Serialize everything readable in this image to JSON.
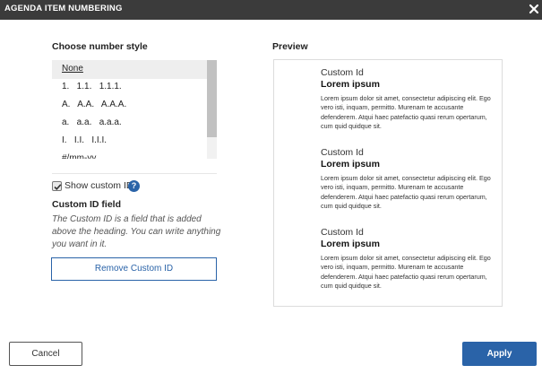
{
  "dialog": {
    "title": "AGENDA ITEM NUMBERING",
    "close_icon": "close-icon"
  },
  "number_style": {
    "label": "Choose number style",
    "options": [
      "None",
      "1.   1.1.   1.1.1.",
      "A.   A.A.   A.A.A.",
      "a.   a.a.   a.a.a.",
      "I.   I.I.   I.I.I.",
      "#/mm-yy"
    ],
    "selected": "None"
  },
  "custom_id": {
    "checkbox_label": "Show custom ID",
    "checked": true,
    "help_icon": "question-circle-icon",
    "help_glyph": "?",
    "field_label": "Custom ID field",
    "help_text": "The Custom ID is a field that is added above the heading. You can write anything you want in it.",
    "remove_button": "Remove Custom ID"
  },
  "preview": {
    "label": "Preview",
    "entries": [
      {
        "id": "Custom Id",
        "title": "Lorem ipsum",
        "body": "Lorem ipsum dolor sit amet, consectetur adipiscing elit. Ego vero isti, inquam, permitto. Murenam te accusante defenderem. Atqui haec patefactio quasi rerum opertarum, cum quid quidque sit."
      },
      {
        "id": "Custom Id",
        "title": "Lorem ipsum",
        "body": "Lorem ipsum dolor sit amet, consectetur adipiscing elit. Ego vero isti, inquam, permitto. Murenam te accusante defenderem. Atqui haec patefactio quasi rerum opertarum, cum quid quidque sit."
      },
      {
        "id": "Custom Id",
        "title": "Lorem ipsum",
        "body": "Lorem ipsum dolor sit amet, consectetur adipiscing elit. Ego vero isti, inquam, permitto. Murenam te accusante defenderem. Atqui haec patefactio quasi rerum opertarum, cum quid quidque sit."
      }
    ]
  },
  "footer": {
    "cancel_label": "Cancel",
    "apply_label": "Apply"
  },
  "colors": {
    "header_bg": "#3b3b3b",
    "accent": "#2a63a8"
  }
}
